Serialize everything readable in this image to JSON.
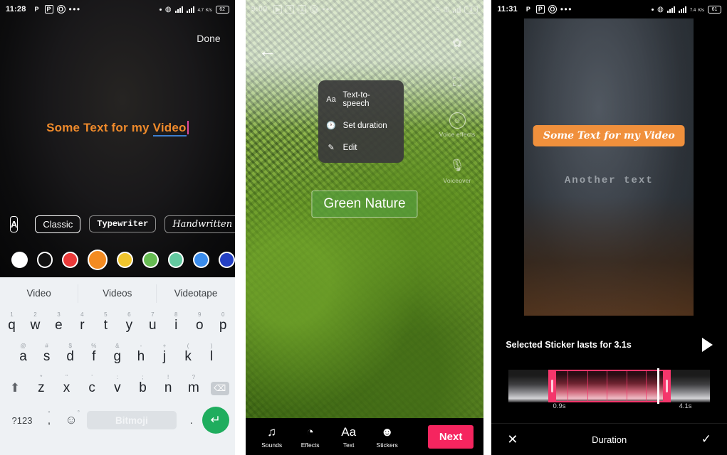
{
  "panel1": {
    "statusbar": {
      "time": "11:28",
      "icons": [
        "P",
        "P",
        "O"
      ],
      "overflow": "•••",
      "net_speed": "4.7",
      "net_unit": "K/s",
      "signal_label": "4G",
      "battery": "62"
    },
    "done_label": "Done",
    "editor": {
      "text_before": "Some Text for my ",
      "text_misspelled": "Video",
      "text_color": "#ef8a2b",
      "caret_color": "#e0499b",
      "underline_color": "#3c7fd0"
    },
    "toolbar": {
      "style_icon": "A",
      "align_icon": "align-icon",
      "fonts": [
        {
          "label": "Classic",
          "selected": true
        },
        {
          "label": "Typewriter",
          "selected": false
        },
        {
          "label": "Handwritten",
          "selected": false
        }
      ]
    },
    "colors": [
      {
        "name": "white",
        "hex": "#ffffff",
        "selected": false
      },
      {
        "name": "black",
        "hex": "#111111",
        "selected": false
      },
      {
        "name": "red",
        "hex": "#ea3a3a",
        "selected": false
      },
      {
        "name": "orange",
        "hex": "#f38b22",
        "selected": true
      },
      {
        "name": "yellow",
        "hex": "#f0c52e",
        "selected": false
      },
      {
        "name": "green",
        "hex": "#66bb52",
        "selected": false
      },
      {
        "name": "mint",
        "hex": "#63c9a0",
        "selected": false
      },
      {
        "name": "blue",
        "hex": "#3b8ded",
        "selected": false
      },
      {
        "name": "indigo",
        "hex": "#2440c4",
        "selected": false
      }
    ],
    "keyboard": {
      "suggestions": [
        "Video",
        "Videos",
        "Videotape"
      ],
      "row1": [
        {
          "key": "q",
          "alt": "1"
        },
        {
          "key": "w",
          "alt": "2"
        },
        {
          "key": "e",
          "alt": "3"
        },
        {
          "key": "r",
          "alt": "4"
        },
        {
          "key": "t",
          "alt": "5"
        },
        {
          "key": "y",
          "alt": "6"
        },
        {
          "key": "u",
          "alt": "7"
        },
        {
          "key": "i",
          "alt": "8"
        },
        {
          "key": "o",
          "alt": "9"
        },
        {
          "key": "p",
          "alt": "0"
        }
      ],
      "row2": [
        {
          "key": "a",
          "alt": "@"
        },
        {
          "key": "s",
          "alt": "#"
        },
        {
          "key": "d",
          "alt": "$"
        },
        {
          "key": "f",
          "alt": "%"
        },
        {
          "key": "g",
          "alt": "&"
        },
        {
          "key": "h",
          "alt": "-"
        },
        {
          "key": "j",
          "alt": "+"
        },
        {
          "key": "k",
          "alt": "("
        },
        {
          "key": "l",
          "alt": ")"
        }
      ],
      "row3": [
        {
          "key": "z",
          "alt": "*"
        },
        {
          "key": "x",
          "alt": "\""
        },
        {
          "key": "c",
          "alt": "'"
        },
        {
          "key": "v",
          "alt": ":"
        },
        {
          "key": "b",
          "alt": ";"
        },
        {
          "key": "n",
          "alt": "!"
        },
        {
          "key": "m",
          "alt": "?"
        }
      ],
      "shift_icon": "⬆",
      "backspace_icon": "⌫",
      "numbers_key": "?123",
      "comma_key": ",",
      "comma_alt": "°",
      "emoji_key": "☺",
      "emoji_alt": "°",
      "space_label": "Bitmoji",
      "period_key": ".",
      "enter_icon": "↵",
      "enter_color": "#1fad5e"
    }
  },
  "panel2": {
    "statusbar": {
      "time": "9:00",
      "overflow": "•••"
    },
    "back_icon": "←",
    "side_tools": [
      {
        "name": "stickers-tool",
        "glyph": "✿",
        "label": ""
      },
      {
        "name": "crop-tool",
        "glyph": "⛶",
        "label": ""
      },
      {
        "name": "voice-effects-tool",
        "glyph": "☺",
        "label": "Voice effects"
      },
      {
        "name": "voiceover-tool",
        "glyph": "🎙",
        "label": "Voiceover"
      }
    ],
    "context_menu": [
      {
        "label": "Text-to-speech",
        "icon": "Aa"
      },
      {
        "label": "Set duration",
        "icon": "🕐"
      },
      {
        "label": "Edit",
        "icon": "✎"
      }
    ],
    "overlay_text": "Green Nature",
    "bottom_tools": [
      {
        "label": "Sounds",
        "glyph": "♫"
      },
      {
        "label": "Effects",
        "glyph": "◔"
      },
      {
        "label": "Text",
        "glyph": "Aa"
      },
      {
        "label": "Stickers",
        "glyph": "☻"
      }
    ],
    "next_label": "Next",
    "next_color": "#f5255f"
  },
  "panel3": {
    "statusbar": {
      "time": "11:31",
      "icons": [
        "P",
        "P",
        "O"
      ],
      "overflow": "•••",
      "net_speed": "7.4",
      "net_unit": "K/s",
      "signal_label": "4G",
      "battery": "61"
    },
    "overlays": [
      {
        "text": "Some Text for my Video",
        "style": "handwritten",
        "bg": "#f0903c"
      },
      {
        "text": "Another text",
        "style": "typewriter",
        "color": "#9aa0a6"
      }
    ],
    "sticker_info": "Selected Sticker lasts for 3.1s",
    "play_icon": "play-icon",
    "timeline": {
      "start_label": "0.9s",
      "end_label": "4.1s",
      "selection_color": "#f4366b",
      "playhead_color": "#ffffff"
    },
    "bottom": {
      "cancel_icon": "✕",
      "title": "Duration",
      "confirm_icon": "✓"
    }
  }
}
